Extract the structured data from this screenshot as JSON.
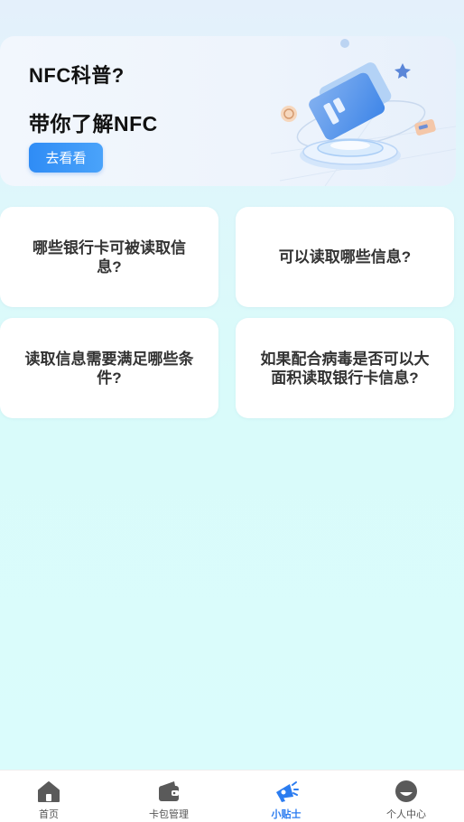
{
  "banner": {
    "title": "NFC科普?",
    "subtitle": "带你了解NFC",
    "button_label": "去看看"
  },
  "questions": [
    {
      "text": "哪些银行卡可被读取信息?"
    },
    {
      "text": "可以读取哪些信息?"
    },
    {
      "text": "读取信息需要满足哪些条件?"
    },
    {
      "text": "如果配合病毒是否可以大面积读取银行卡信息?"
    }
  ],
  "tabbar": {
    "items": [
      {
        "label": "首页",
        "icon": "home-icon",
        "active": false
      },
      {
        "label": "卡包管理",
        "icon": "wallet-icon",
        "active": false
      },
      {
        "label": "小贴士",
        "icon": "megaphone-icon",
        "active": true
      },
      {
        "label": "个人中心",
        "icon": "profile-icon",
        "active": false
      }
    ]
  },
  "colors": {
    "accent": "#2b7cf0",
    "tab_inactive": "#555555",
    "background": "#dafcfc"
  }
}
